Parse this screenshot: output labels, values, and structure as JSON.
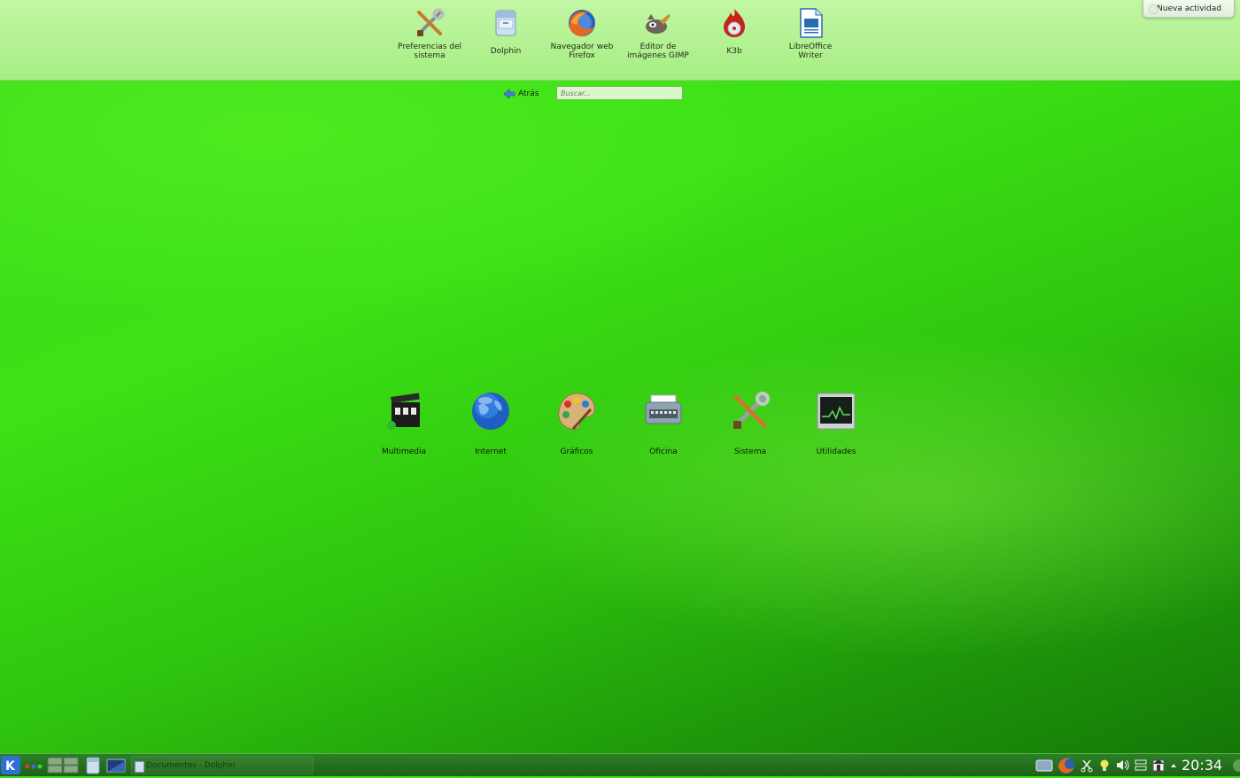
{
  "top_right": {
    "new_activity": "Nueva actividad"
  },
  "favorites": [
    {
      "label": "Preferencias del\nsistema",
      "icon": "system-settings-icon"
    },
    {
      "label": "Dolphin",
      "icon": "dolphin-icon"
    },
    {
      "label": "Navegador web\nFirefox",
      "icon": "firefox-icon"
    },
    {
      "label": "Editor de\nimágenes GIMP",
      "icon": "gimp-icon"
    },
    {
      "label": "K3b",
      "icon": "k3b-icon"
    },
    {
      "label": "LibreOffice\nWriter",
      "icon": "libreoffice-writer-icon"
    }
  ],
  "nav": {
    "back_label": "Atrás",
    "search_placeholder": "Buscar..."
  },
  "categories": [
    {
      "label": "Multimedia",
      "icon": "multimedia-icon"
    },
    {
      "label": "Internet",
      "icon": "internet-globe-icon"
    },
    {
      "label": "Gráficos",
      "icon": "graphics-palette-icon"
    },
    {
      "label": "Oficina",
      "icon": "office-typewriter-icon"
    },
    {
      "label": "Sistema",
      "icon": "system-tools-icon"
    },
    {
      "label": "Utilidades",
      "icon": "utilities-monitor-icon"
    }
  ],
  "taskbar": {
    "task_label": "Documentos - Dolphin",
    "clock": "20:34"
  }
}
